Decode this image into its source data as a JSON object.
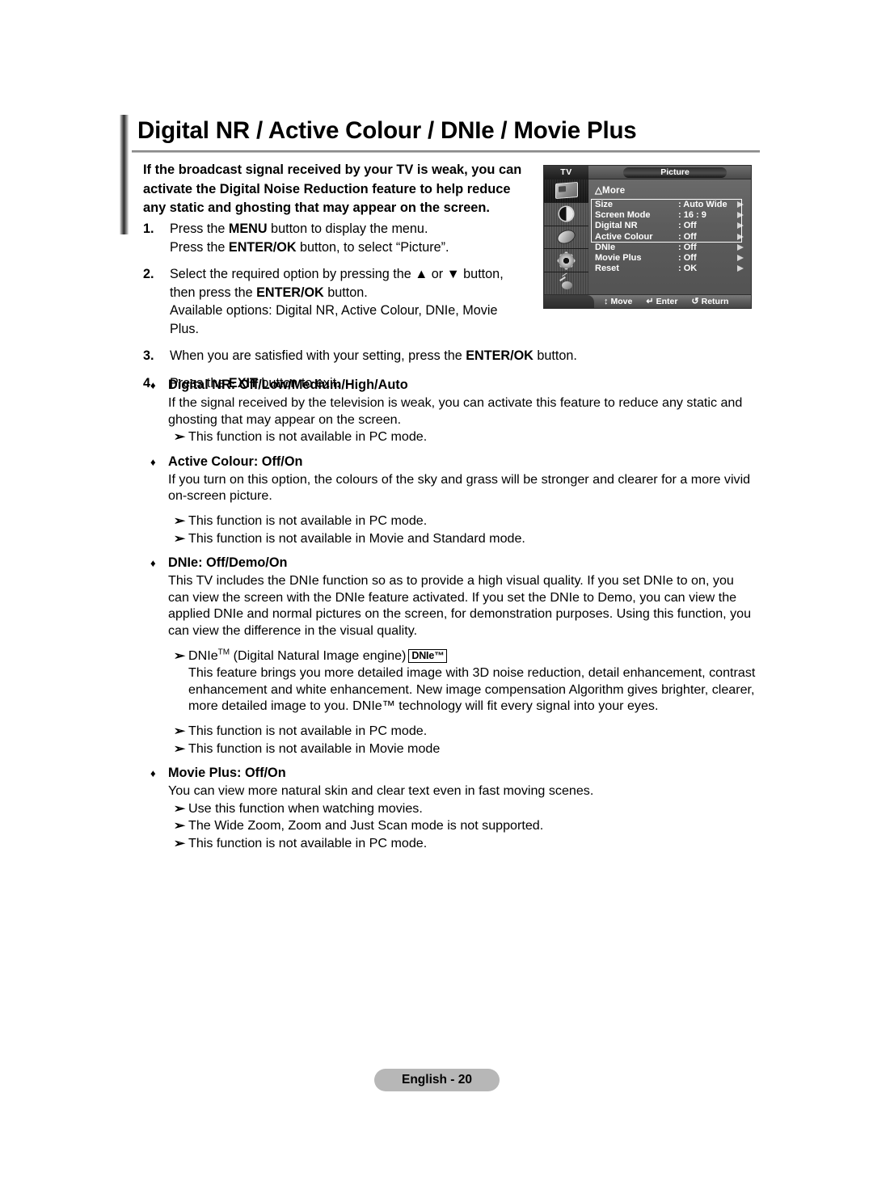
{
  "page": {
    "title": "Digital NR / Active Colour / DNIe / Movie Plus",
    "footer": "English - 20"
  },
  "intro": {
    "line1": "If the broadcast signal received by your TV is weak, you can",
    "line2": "activate the Digital Noise Reduction feature to help reduce",
    "line3": "any static and ghosting that may appear on the screen."
  },
  "steps": [
    {
      "num": "1.",
      "lines": [
        {
          "pre": "Press the ",
          "bold": "MENU",
          "post": " button to display the menu."
        },
        {
          "pre": "Press the ",
          "bold": "ENTER/OK",
          "post": " button, to select “Picture”."
        }
      ]
    },
    {
      "num": "2.",
      "lines": [
        {
          "pre": "Select the required option by pressing the ▲ or ▼ button,",
          "bold": "",
          "post": ""
        },
        {
          "pre": "then press the ",
          "bold": "ENTER/OK",
          "post": " button."
        },
        {
          "pre": "Available options: Digital NR, Active Colour, DNIe, Movie",
          "bold": "",
          "post": ""
        },
        {
          "pre": "Plus.",
          "bold": "",
          "post": ""
        }
      ]
    },
    {
      "num": "3.",
      "lines": [
        {
          "pre": "When you are satisfied with your setting, press the ",
          "bold": "ENTER/OK",
          "post": " button."
        }
      ]
    },
    {
      "num": "4.",
      "lines": [
        {
          "pre": "Press the ",
          "bold": "EXIT",
          "post": " button to exit."
        }
      ]
    }
  ],
  "osd": {
    "source_label": "TV",
    "menu_title": "Picture",
    "more_label": "△More",
    "rows": [
      {
        "label": "Size",
        "value": ": Auto Wide"
      },
      {
        "label": "Screen Mode",
        "value": ": 16 : 9"
      },
      {
        "label": "Digital NR",
        "value": ": Off"
      },
      {
        "label": "Active Colour",
        "value": ": Off"
      },
      {
        "label": "DNIe",
        "value": ": Off"
      },
      {
        "label": "Movie Plus",
        "value": ": Off"
      },
      {
        "label": "Reset",
        "value": ": OK"
      }
    ],
    "hints": [
      {
        "glyph": "↕",
        "label": "Move"
      },
      {
        "glyph": "↵",
        "label": "Enter"
      },
      {
        "glyph": "↺",
        "label": "Return"
      }
    ],
    "icons": [
      "picture-icon",
      "sound-icon",
      "channel-icon",
      "setup-icon",
      "input-icon"
    ],
    "highlight_rows": [
      "Digital NR",
      "Active Colour",
      "DNIe",
      "Movie Plus"
    ]
  },
  "features": [
    {
      "heading": "Digital NR: Off/Low/Medium/High/Auto",
      "desc": "If the signal received by the television is weak, you can activate this feature to reduce any static and ghosting that may appear on the screen.",
      "notes": [
        "This function is not available in PC mode."
      ]
    },
    {
      "heading": "Active Colour: Off/On",
      "desc": "If you turn on this option, the colours of the sky and grass will be stronger and clearer for a more vivid on-screen picture.",
      "notes": [
        "This function is not available in PC mode.",
        "This function is not available in Movie and Standard mode."
      ]
    },
    {
      "heading": "DNIe: Off/Demo/On",
      "desc": "This TV includes the DNIe function so as to provide a high visual quality. If you set DNIe to on, you can view the screen with the DNIe feature activated. If you set the DNIe to Demo, you can view the applied DNIe and normal pictures on the screen, for demonstration purposes. Using this function, you can view the difference in the visual quality.",
      "dnie_note": {
        "title_pre": "DNIe",
        "title_tm": "TM",
        "title_post": " (Digital Natural Image engine)",
        "badge": "DNIe™",
        "body": "This feature brings you more detailed image with 3D noise reduction, detail enhancement, contrast enhancement and white enhancement. New image compensation Algorithm gives brighter, clearer, more detailed image to you. DNIe™ technology will fit every signal into your eyes."
      },
      "notes": [
        "This function is not available in PC mode.",
        "This function is not available in Movie mode"
      ]
    },
    {
      "heading": "Movie Plus: Off/On",
      "desc": "You can view more natural skin and clear text even in fast moving scenes.",
      "notes": [
        "Use this function when watching movies.",
        "The Wide Zoom, Zoom and Just Scan mode is not supported.",
        "This function is not available in PC mode."
      ]
    }
  ],
  "glyphs": {
    "diamond": "♦",
    "note_arrow": "➢"
  }
}
